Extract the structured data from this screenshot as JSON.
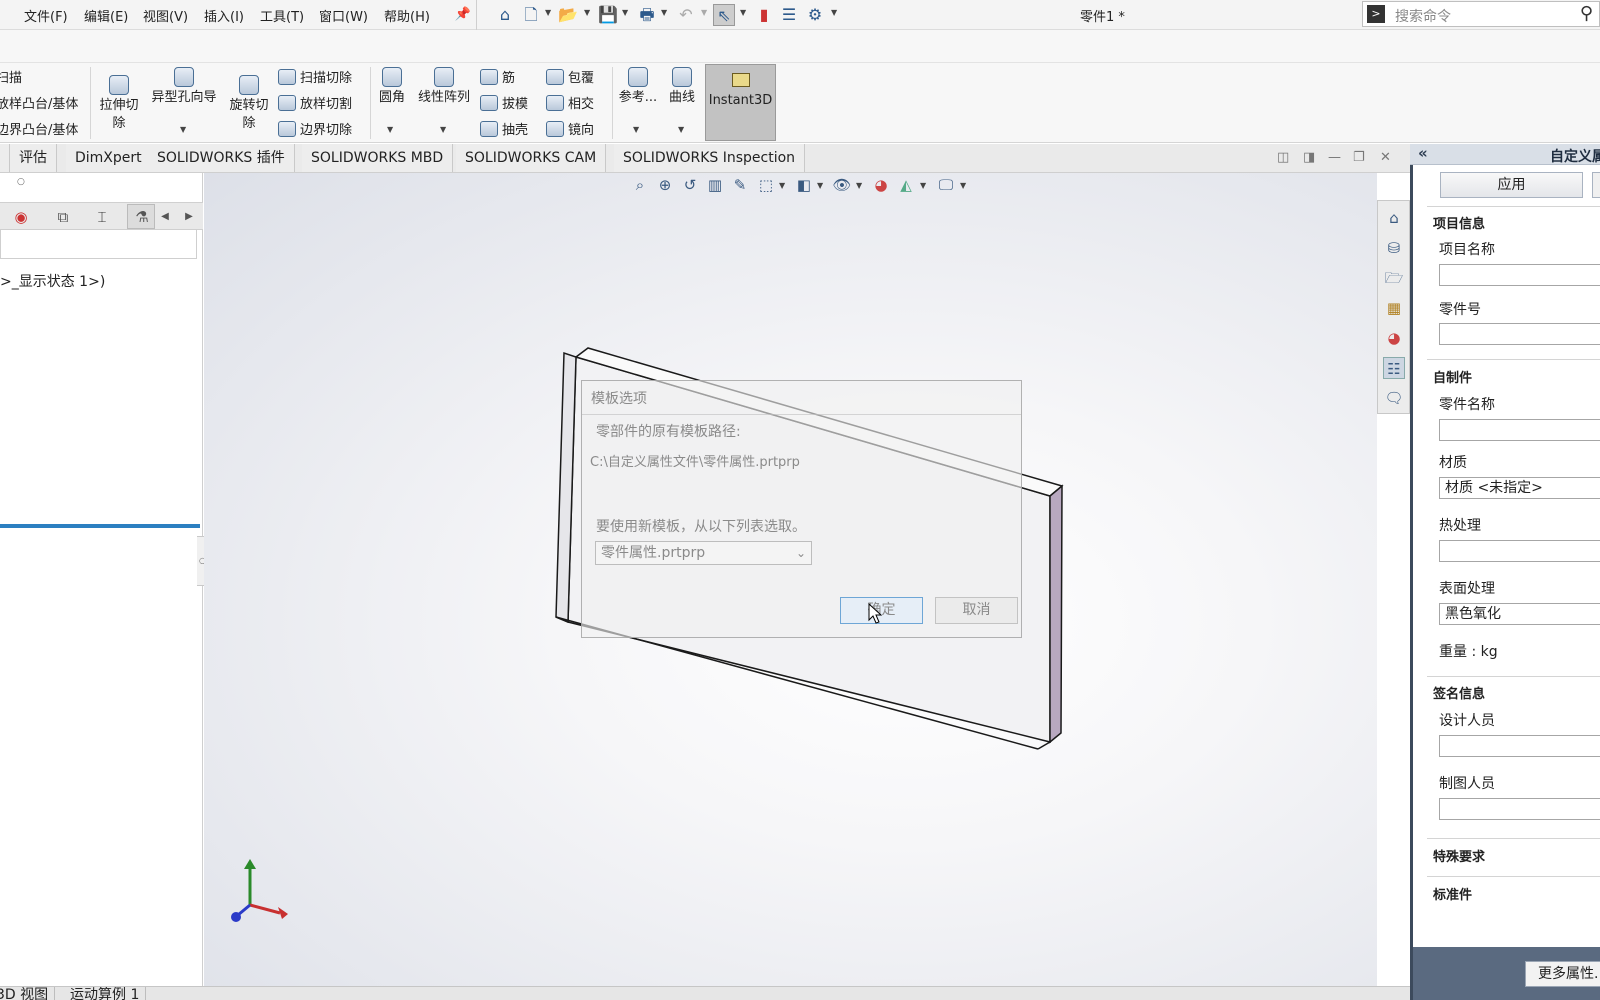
{
  "menu": {
    "items": [
      "文件(F)",
      "编辑(E)",
      "视图(V)",
      "插入(I)",
      "工具(T)",
      "窗口(W)",
      "帮助(H)"
    ],
    "pin_icon": "pin-icon"
  },
  "quick_access": {
    "icons": [
      "home-icon",
      "new-document-icon",
      "open-file-icon",
      "save-icon",
      "print-icon",
      "undo-icon",
      "select-pointer-icon",
      "rebuild-icon",
      "file-properties-icon",
      "options-gear-icon"
    ]
  },
  "document_title": "零件1 *",
  "search": {
    "placeholder": "搜索命令"
  },
  "ribbon": {
    "left_partial": [
      "扫描",
      "放样凸台/基体",
      "边界凸台/基体"
    ],
    "extrude_cut": "拉伸切\n除",
    "hole_wizard": "异型孔向导",
    "revolve_cut": "旋转切\n除",
    "cut_group": [
      "扫描切除",
      "放样切割",
      "边界切除"
    ],
    "fillet": "圆角",
    "linear_pattern": "线性阵列",
    "features_col1": [
      "筋",
      "拔模",
      "抽壳"
    ],
    "features_col2": [
      "包覆",
      "相交",
      "镜向"
    ],
    "reference": "参考...",
    "curves": "曲线",
    "instant3d": "Instant3D"
  },
  "tabs": [
    "评估",
    "DimXpert",
    "SOLIDWORKS 插件",
    "SOLIDWORKS MBD",
    "SOLIDWORKS CAM",
    "SOLIDWORKS Inspection"
  ],
  "tree": {
    "display_state": ">_显示状态 1>)"
  },
  "dialog": {
    "title": "模板选项",
    "original_label": "零部件的原有模板路径:",
    "original_path": "C:\\自定义属性文件\\零件属性.prtprp",
    "new_label": "要使用新模板，从以下列表选取。",
    "selected_template": "零件属性.prtprp",
    "ok": "确定",
    "cancel": "取消"
  },
  "property_pane": {
    "title": "自定义属",
    "apply": "应用",
    "section_project": "项目信息",
    "project_name_label": "项目名称",
    "project_name_value": "",
    "part_no_label": "零件号",
    "part_no_value": "",
    "section_self_made": "自制件",
    "part_name_label": "零件名称",
    "part_name_value": "",
    "material_label": "材质",
    "material_value": "材质 <未指定>",
    "heat_treat_label": "热处理",
    "heat_treat_value": "",
    "surface_label": "表面处理",
    "surface_value": "黑色氧化",
    "weight_label": "重量 : kg",
    "section_sign": "签名信息",
    "designer_label": "设计人员",
    "designer_value": "",
    "drafter_label": "制图人员",
    "drafter_value": "",
    "section_special": "特殊要求",
    "section_standard": "标准件",
    "more": "更多属性..."
  },
  "bottom_tabs": [
    "3D 视图",
    "运动算例 1"
  ],
  "colors": {
    "accent_blue": "#2b7fc1",
    "pane_dark": "#3c4a5c",
    "part_face": "#f0f0f2",
    "part_side": "#b8a8c0"
  }
}
